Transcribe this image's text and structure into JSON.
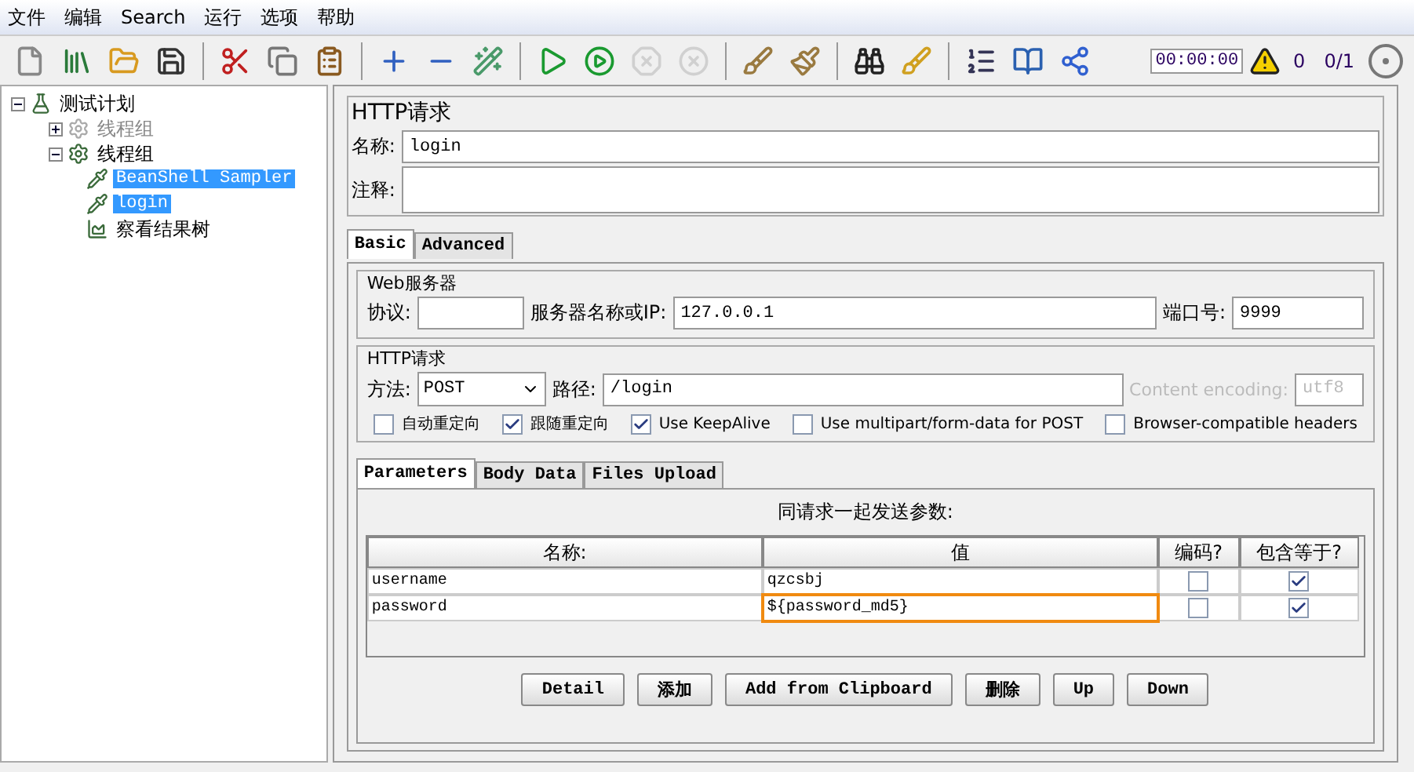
{
  "menu": [
    "文件",
    "编辑",
    "Search",
    "运行",
    "选项",
    "帮助"
  ],
  "toolbar": [
    {
      "kind": "new",
      "disabled": false
    },
    {
      "kind": "templates",
      "disabled": false
    },
    {
      "kind": "open",
      "disabled": false
    },
    {
      "kind": "save",
      "disabled": false
    },
    {
      "kind": "separator"
    },
    {
      "kind": "cut",
      "disabled": false
    },
    {
      "kind": "copy",
      "disabled": false
    },
    {
      "kind": "paste",
      "disabled": false
    },
    {
      "kind": "separator"
    },
    {
      "kind": "expand",
      "disabled": false
    },
    {
      "kind": "collapse",
      "disabled": false
    },
    {
      "kind": "toggle",
      "disabled": false
    },
    {
      "kind": "separator"
    },
    {
      "kind": "start",
      "disabled": false
    },
    {
      "kind": "start-no-pause",
      "disabled": false
    },
    {
      "kind": "stop",
      "disabled": true
    },
    {
      "kind": "shutdown",
      "disabled": true
    },
    {
      "kind": "separator"
    },
    {
      "kind": "clear",
      "disabled": false
    },
    {
      "kind": "clear-all",
      "disabled": false
    },
    {
      "kind": "separator"
    },
    {
      "kind": "search",
      "disabled": false
    },
    {
      "kind": "reset-search",
      "disabled": false
    },
    {
      "kind": "separator"
    },
    {
      "kind": "functions",
      "disabled": false
    },
    {
      "kind": "help",
      "disabled": false
    },
    {
      "kind": "remote",
      "disabled": false
    }
  ],
  "status": {
    "timer": "00:00:00",
    "warnings": "0",
    "threads": "0/1"
  },
  "tree": [
    {
      "label": "测试计划",
      "kind": "plan",
      "expanded": true,
      "selected": false,
      "disabled": false,
      "children": [
        {
          "label": "线程组",
          "kind": "thread-group",
          "expanded": false,
          "selected": false,
          "disabled": true
        },
        {
          "label": "线程组",
          "kind": "thread-group",
          "expanded": true,
          "selected": false,
          "disabled": false,
          "children": [
            {
              "label": "BeanShell Sampler",
              "kind": "sampler",
              "selected": true,
              "disabled": false
            },
            {
              "label": "login",
              "kind": "sampler",
              "selected": true,
              "disabled": false
            },
            {
              "label": "察看结果树",
              "kind": "listener",
              "selected": false,
              "disabled": false
            }
          ]
        }
      ]
    }
  ],
  "editor": {
    "title": "HTTP请求",
    "name_label": "名称:",
    "name": "login",
    "comment_label": "注释:",
    "tabs": [
      {
        "label": "Basic",
        "selected": true
      },
      {
        "label": "Advanced",
        "selected": false
      }
    ],
    "web_server": {
      "legend": "Web服务器",
      "protocol_label": "协议:",
      "server_label": "服务器名称或IP:",
      "server": "127.0.0.1",
      "port_label": "端口号:",
      "port": "9999"
    },
    "http_request": {
      "legend": "HTTP请求",
      "method_label": "方法:",
      "method": "POST",
      "path_label": "路径:",
      "path": "/login",
      "encoding_label": "Content encoding:",
      "encoding": "utf8",
      "options": [
        {
          "label": "自动重定向",
          "checked": false
        },
        {
          "label": "跟随重定向",
          "checked": true
        },
        {
          "label": "Use KeepAlive",
          "checked": true
        },
        {
          "label": "Use multipart/form-data for POST",
          "checked": false
        },
        {
          "label": "Browser-compatible headers",
          "checked": false
        }
      ]
    },
    "param_tabs": [
      {
        "label": "Parameters",
        "selected": true
      },
      {
        "label": "Body Data",
        "selected": false
      },
      {
        "label": "Files Upload",
        "selected": false
      }
    ],
    "params_caption": "同请求一起发送参数:",
    "columns": [
      "名称:",
      "值",
      "编码?",
      "包含等于?"
    ],
    "rows": [
      {
        "name": "username",
        "value": "qzcsbj",
        "encode": false,
        "include_equals": true,
        "highlighted": false
      },
      {
        "name": "password",
        "value": "${password_md5}",
        "encode": false,
        "include_equals": true,
        "highlighted": true
      }
    ],
    "buttons": [
      "Detail",
      "添加",
      "Add from Clipboard",
      "删除",
      "Up",
      "Down"
    ]
  }
}
